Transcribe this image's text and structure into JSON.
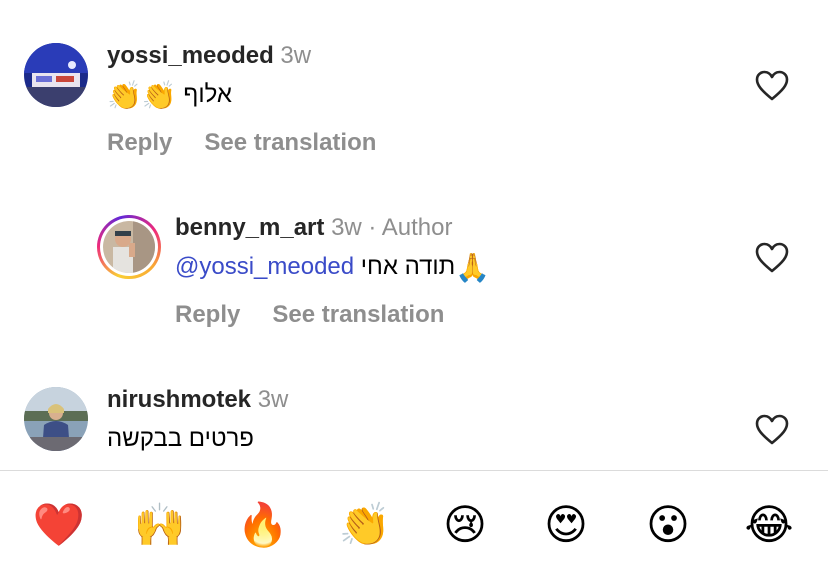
{
  "comments": [
    {
      "username": "yossi_meoded",
      "time": "3w",
      "text": "אלוף",
      "emoji": "👏👏",
      "reply_label": "Reply",
      "translate_label": "See translation"
    },
    {
      "username": "benny_m_art",
      "time": "3w",
      "separator": "·",
      "author_badge": "Author",
      "mention": "@yossi_meoded",
      "text": "תודה אחי",
      "emoji": "🙏",
      "reply_label": "Reply",
      "translate_label": "See translation"
    },
    {
      "username": "nirushmotek",
      "time": "3w",
      "text": "פרטים בבקשה"
    }
  ],
  "reactions": [
    "❤️",
    "🙌",
    "🔥",
    "👏",
    "😢",
    "😍",
    "😮",
    "😂"
  ],
  "icons": {
    "like": "heart-outline-icon"
  },
  "colors": {
    "mention": "#3a4bc8",
    "secondary_text": "#8e8e8e",
    "story_ring": "#ee2a7b"
  }
}
